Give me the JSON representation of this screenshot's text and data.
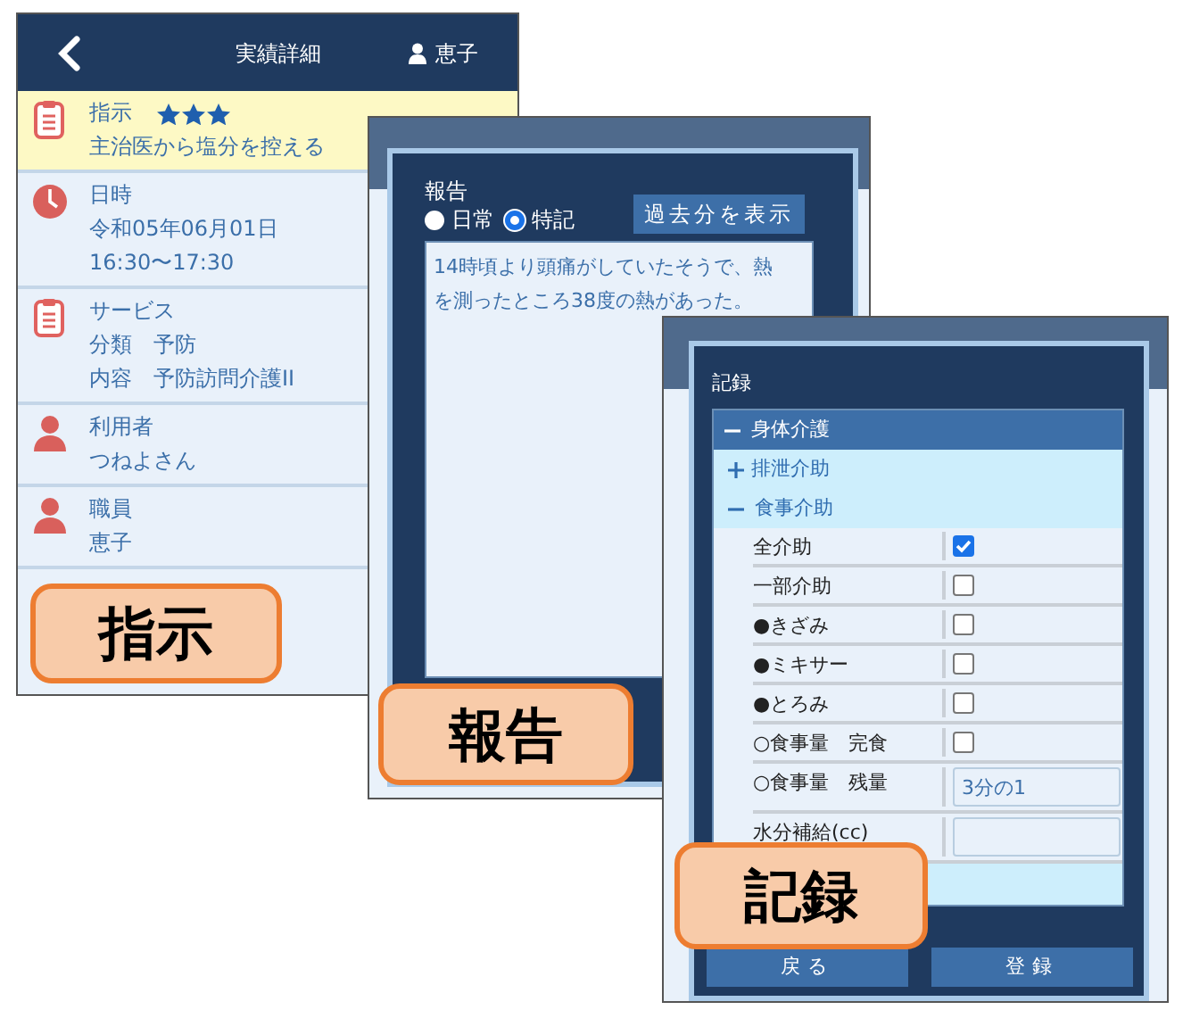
{
  "screens": [
    {
      "kind": "detail",
      "header": {
        "title": "実績詳細",
        "user": "恵子"
      },
      "items": [
        {
          "kind": "document",
          "highlighted": true,
          "title": "指示",
          "stars": 3,
          "lines": [
            "主治医から塩分を控える"
          ]
        },
        {
          "kind": "clock",
          "highlighted": false,
          "title": "日時",
          "lines": [
            "令和05年06月01日",
            "16:30〜17:30"
          ]
        },
        {
          "kind": "document",
          "highlighted": false,
          "title": "サービス",
          "lines": [
            "分類　予防",
            "内容　予防訪問介護II"
          ]
        },
        {
          "kind": "person",
          "highlighted": false,
          "title": "利用者",
          "lines": [
            "つねよさん"
          ]
        },
        {
          "kind": "person",
          "highlighted": false,
          "title": "職員",
          "lines": [
            "恵子"
          ]
        }
      ],
      "caption": "指示"
    },
    {
      "kind": "report",
      "title": "報告",
      "radios": [
        {
          "label": "日常",
          "selected": false
        },
        {
          "label": "特記",
          "selected": true
        }
      ],
      "button": "過去分を表示",
      "text": "14時頃より頭痛がしていたそうで、熱を測ったところ38度の熱があった。",
      "caption": "報告"
    },
    {
      "kind": "record",
      "title": "記録",
      "tree": [
        {
          "label": "身体介護",
          "expanded": true,
          "children": [
            {
              "label": "排泄介助",
              "expanded": false
            },
            {
              "label": "食事介助",
              "expanded": true,
              "children": [
                {
                  "kind": "checkbox",
                  "label": "全介助",
                  "checked": true
                },
                {
                  "kind": "checkbox",
                  "label": "一部介助",
                  "checked": false
                },
                {
                  "kind": "checkbox",
                  "label": "●きざみ",
                  "checked": false
                },
                {
                  "kind": "checkbox",
                  "label": "●ミキサー",
                  "checked": false
                },
                {
                  "kind": "checkbox",
                  "label": "●とろみ",
                  "checked": false
                },
                {
                  "kind": "checkbox",
                  "label": "○食事量　完食",
                  "checked": false
                },
                {
                  "kind": "input",
                  "label": "○食事量　残量",
                  "value": "3分の1"
                },
                {
                  "kind": "input",
                  "label": "水分補給(cc)"
                }
              ]
            }
          ]
        }
      ],
      "buttons": [
        "戻る",
        "登録"
      ],
      "caption": "記録"
    }
  ]
}
